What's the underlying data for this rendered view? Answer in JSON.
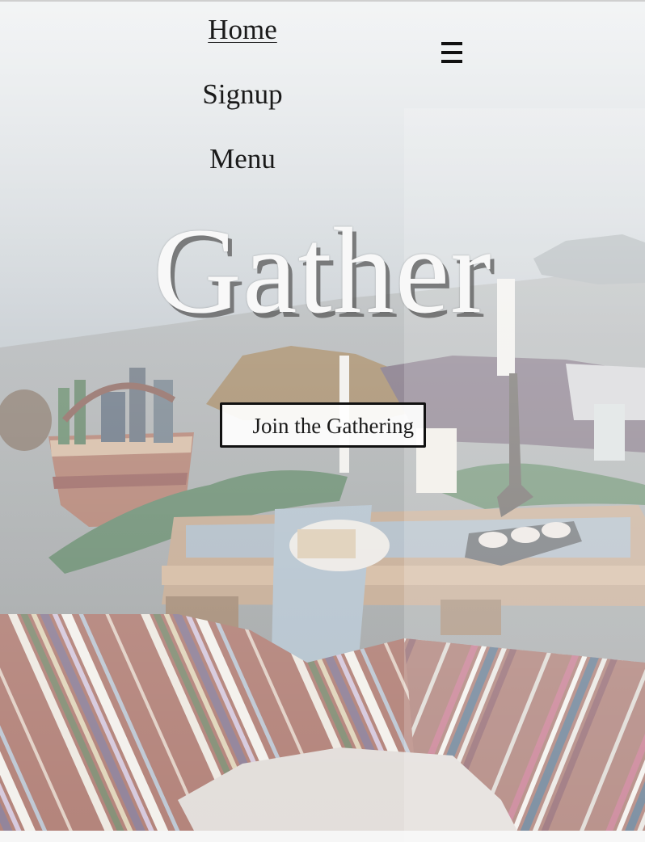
{
  "nav": {
    "items": [
      {
        "label": "Home",
        "active": true
      },
      {
        "label": "Signup",
        "active": false
      },
      {
        "label": "Menu",
        "active": false
      }
    ],
    "menu_icon": "hamburger-menu-icon"
  },
  "hero": {
    "title": "Gather",
    "cta_label": "Join the Gathering",
    "image": "picnic-table-on-beach-photo"
  },
  "colors": {
    "text": "#1a1a1a",
    "title": "#f8f8f8",
    "button_border": "#111111"
  }
}
